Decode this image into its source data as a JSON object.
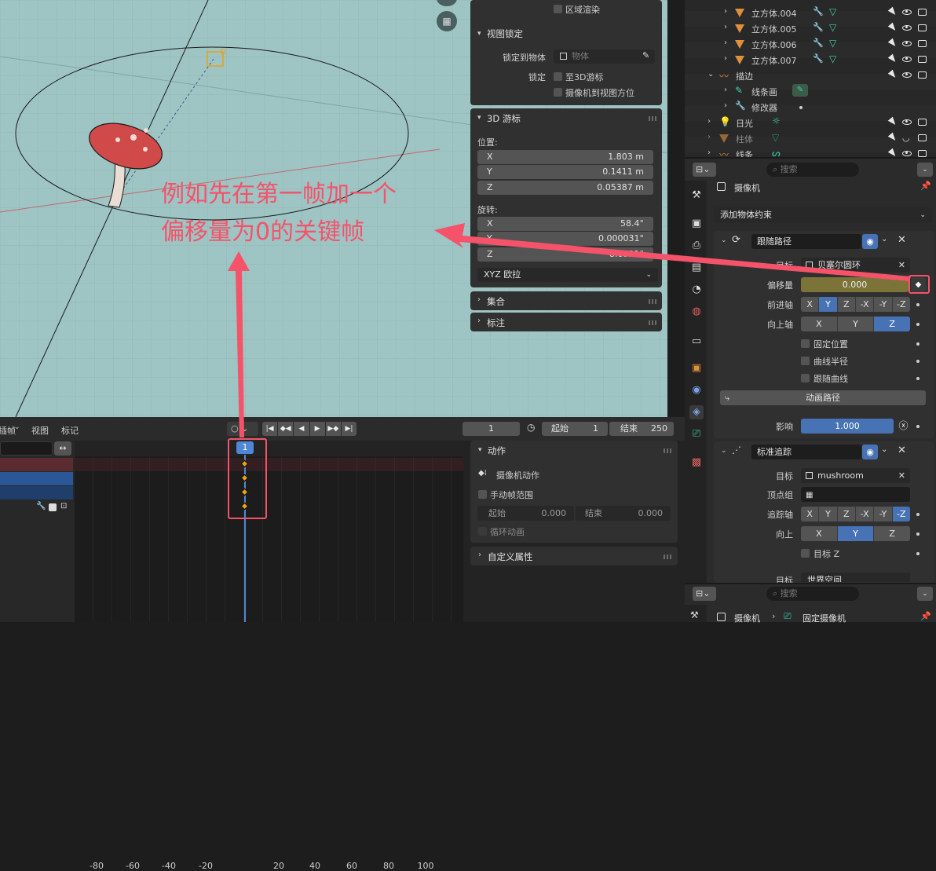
{
  "sidebar_viewport": {
    "region_render": "区域渲染",
    "view_lock_header": "视图锁定",
    "lock_to_object_label": "锁定到物体",
    "lock_to_object_placeholder": "物体",
    "lock_label": "锁定",
    "lock_3d_cursor": "至3D游标",
    "lock_camera_to_view": "摄像机到视图方位",
    "cursor_header": "3D 游标",
    "location_label": "位置:",
    "loc_x_label": "X",
    "loc_x": "1.803 m",
    "loc_y_label": "Y",
    "loc_y": "0.1411 m",
    "loc_z_label": "Z",
    "loc_z": "0.05387 m",
    "rotation_label": "旋转:",
    "rot_x_label": "X",
    "rot_x": "58.4°",
    "rot_y_label": "Y",
    "rot_y": "0.000031°",
    "rot_z_label": "Z",
    "rot_z": "8.6921°",
    "rotation_mode": "XYZ 欧拉",
    "collection_header": "集合",
    "annotation_header": "标注"
  },
  "annotation": {
    "line1": "例如先在第一帧加一个",
    "line2": "偏移量为0的关键帧",
    "color": "#f4536a"
  },
  "timeline": {
    "menu_keying": "插帧",
    "menu_view": "视图",
    "menu_marker": "标记",
    "current_frame": "1",
    "start_label": "起始",
    "start_value": "1",
    "end_label": "结束",
    "end_value": "250",
    "ticks": [
      "-80",
      "-60",
      "-40",
      "-20",
      "1",
      "20",
      "40",
      "60",
      "80",
      "100"
    ],
    "keyframe_count": 4
  },
  "action_panel": {
    "header": "动作",
    "camera_action": "摄像机动作",
    "manual_range": "手动帧范围",
    "start_label": "起始",
    "start_value": "0.000",
    "end_label": "结束",
    "end_value": "0.000",
    "cyclic": "循环动画",
    "custom_props": "自定义属性"
  },
  "outliner": {
    "rows": [
      {
        "name": "立方体.004",
        "type": "mesh"
      },
      {
        "name": "立方体.005",
        "type": "mesh"
      },
      {
        "name": "立方体.006",
        "type": "mesh"
      },
      {
        "name": "立方体.007",
        "type": "mesh"
      },
      {
        "name": "描边",
        "type": "gpencil"
      },
      {
        "name": "线条画",
        "type": "gp-layer"
      },
      {
        "name": "修改器",
        "type": "modifier"
      },
      {
        "name": "日光",
        "type": "light"
      },
      {
        "name": "柱体",
        "type": "mesh"
      },
      {
        "name": "线条",
        "type": "curve"
      }
    ]
  },
  "properties": {
    "search_placeholder": "搜索",
    "object_name": "摄像机",
    "add_constraint": "添加物体约束",
    "follow_path": {
      "name": "跟随路径",
      "target_label": "目标",
      "target_value": "贝塞尔圆环",
      "offset_label": "偏移量",
      "offset_value": "0.000",
      "forward_label": "前进轴",
      "forward_axes": [
        "X",
        "Y",
        "Z",
        "-X",
        "-Y",
        "-Z"
      ],
      "forward_active": 1,
      "up_label": "向上轴",
      "up_axes": [
        "X",
        "Y",
        "Z"
      ],
      "up_active": 2,
      "fixed_position": "固定位置",
      "curve_radius": "曲线半径",
      "follow_curve": "跟随曲线",
      "animate_path": "动画路径",
      "influence_label": "影响",
      "influence_value": "1.000"
    },
    "track_to": {
      "name": "标准追踪",
      "target_label": "目标",
      "target_value": "mushroom",
      "vertex_group_label": "顶点组",
      "track_axis_label": "追踪轴",
      "track_axes": [
        "X",
        "Y",
        "Z",
        "-X",
        "-Y",
        "-Z"
      ],
      "track_active": 5,
      "up_label": "向上",
      "up_axes": [
        "X",
        "Y",
        "Z"
      ],
      "up_active": 1,
      "target_z": "目标 Z",
      "cut_label": "目标",
      "cut_value": "世界空间"
    },
    "bottom_search": "搜索",
    "breadcrumb_object": "摄像机",
    "breadcrumb_data": "固定摄像机"
  },
  "colors": {
    "viewport_bg": "#9fc4c4",
    "offset_field": "#7c7338",
    "accent_blue": "#4772b3",
    "highlight_red": "#f4536a"
  }
}
